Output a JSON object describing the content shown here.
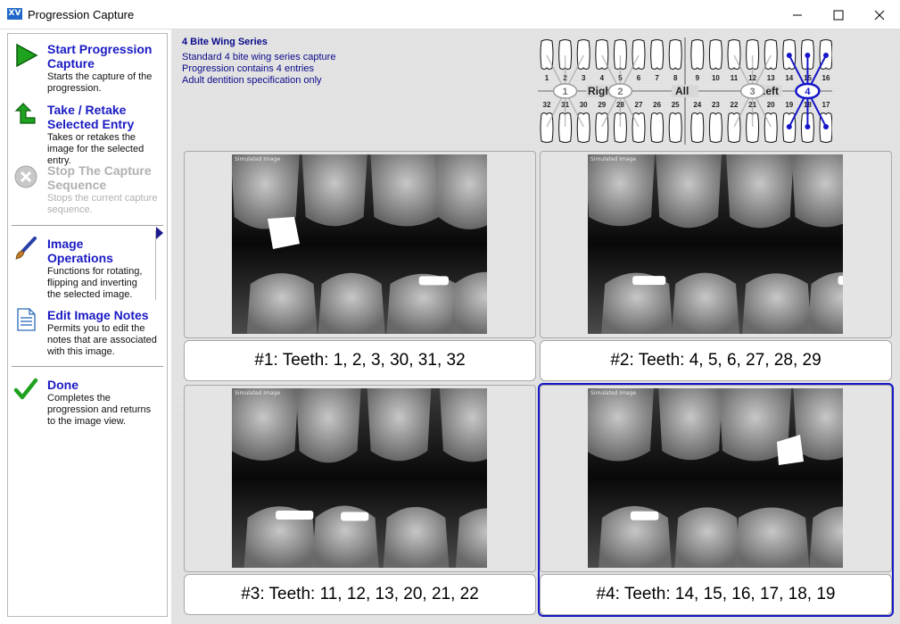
{
  "window": {
    "title": "Progression Capture",
    "app_icon_text": "XV"
  },
  "sidebar": {
    "items": [
      {
        "title": "Start Progression Capture",
        "desc": "Starts the capture of the progression.",
        "enabled": true
      },
      {
        "title": "Take / Retake Selected Entry",
        "desc": "Takes or retakes the image for the selected entry.",
        "enabled": true
      },
      {
        "title": "Stop The Capture Sequence",
        "desc": "Stops the current capture sequence.",
        "enabled": false
      },
      {
        "title": "Image Operations",
        "desc": "Functions for rotating, flipping and inverting the selected image.",
        "enabled": true
      },
      {
        "title": "Edit Image Notes",
        "desc": "Permits you to edit the notes that are associated with this image.",
        "enabled": true
      },
      {
        "title": "Done",
        "desc": "Completes the progression and returns to the image view.",
        "enabled": true
      }
    ]
  },
  "series": {
    "title": "4 Bite Wing Series",
    "lines": [
      "Standard 4 bite wing series capture",
      "Progression contains 4 entries",
      "Adult dentition specification only"
    ]
  },
  "tooth_chart": {
    "upper_numbers": [
      "1",
      "2",
      "3",
      "4",
      "5",
      "6",
      "7",
      "8",
      "9",
      "10",
      "11",
      "12",
      "13",
      "14",
      "15",
      "16"
    ],
    "lower_numbers": [
      "32",
      "31",
      "30",
      "29",
      "28",
      "27",
      "26",
      "25",
      "24",
      "23",
      "22",
      "21",
      "20",
      "19",
      "18",
      "17"
    ],
    "labels": {
      "right": "Right",
      "all": "All",
      "left": "Left"
    },
    "group_markers": [
      "1",
      "2",
      "3",
      "4"
    ],
    "selected_group": "4",
    "colors": {
      "selected": "#1616c8",
      "normal": "#9a9a9a"
    }
  },
  "entries": [
    {
      "caption": "#1: Teeth: 1, 2, 3, 30, 31, 32",
      "image_label": "Simulated Image",
      "selected": false
    },
    {
      "caption": "#2: Teeth: 4, 5, 6, 27, 28, 29",
      "image_label": "Simulated Image",
      "selected": false
    },
    {
      "caption": "#3: Teeth: 11, 12, 13, 20, 21, 22",
      "image_label": "Simulated Image",
      "selected": false
    },
    {
      "caption": "#4: Teeth: 14, 15, 16, 17, 18, 19",
      "image_label": "Simulated Image",
      "selected": true
    }
  ]
}
